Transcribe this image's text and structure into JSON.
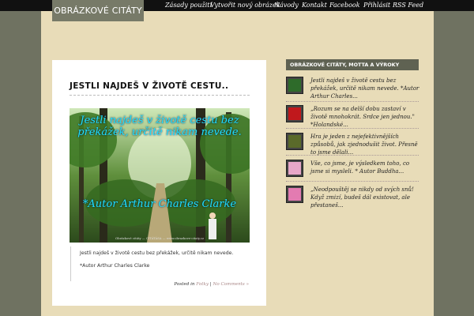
{
  "site": {
    "logo": "OBRÁZKOVÉ CITÁTY"
  },
  "nav": {
    "items": [
      {
        "label": "Zásady použití"
      },
      {
        "label": "Vytvořit nový obrázek"
      },
      {
        "label": "Návody"
      },
      {
        "label": "Kontakt"
      },
      {
        "label": "Facebook"
      },
      {
        "label": "Přihlásit"
      },
      {
        "label": "RSS Feed"
      }
    ]
  },
  "post": {
    "title": "JESTLI NAJDEŠ V ŽIVOTĚ CESTU..",
    "image": {
      "caption_top": "Jestli najdeš v životě cestu bez překážek, určitě nikam nevede.",
      "caption_bottom": "*Autor Arthur Charles Clarke",
      "footer": "Obrázkové citáty — CITÁTÁSA — www.obrazkove-citaty.cz"
    },
    "quote_line1": "Jestli najdeš v životě cestu bez překážek, určitě nikam nevede.",
    "quote_line2": "*Autor Arthur Charles Clarke",
    "meta_prefix": "Posted in",
    "meta_category": "Fotky",
    "meta_separator": "|",
    "meta_comments": "No Comments »"
  },
  "sidebar": {
    "widget_title": "OBRÁZKOVÉ CITÁTY, MOTTA A VÝROKY",
    "items": [
      {
        "text": "Jestli najdeš v životě cestu bez překážek, určitě nikam nevede. *Autor Arthur Charles...",
        "thumb_icon": "forest-thumbnail",
        "thumb_color": "#2e6b2a"
      },
      {
        "text": "„Rozum se na delší dobu zastaví v životě mnohokrát. Srdce jen jednou.\" *Holandské...",
        "thumb_icon": "heart-thumbnail",
        "thumb_color": "#c0181c"
      },
      {
        "text": "Hra je jeden z nejefektivnějších způsobů, jak zjednodušit život. Přesně to jsme dělali...",
        "thumb_icon": "chess-thumbnail",
        "thumb_color": "#5a6a2a"
      },
      {
        "text": "Vše, co jsme, je výsledkem toho, co jsme si mysleli. * Autor Buddha...",
        "thumb_icon": "pink-card-thumbnail",
        "thumb_color": "#e7a7c8"
      },
      {
        "text": "„Neodpouštěj se nikdy od svých snů! Když zmizí, budeš dál existovat, ale přestaneš...",
        "thumb_icon": "pink-frame-thumbnail",
        "thumb_color": "#e37bb1"
      }
    ]
  }
}
